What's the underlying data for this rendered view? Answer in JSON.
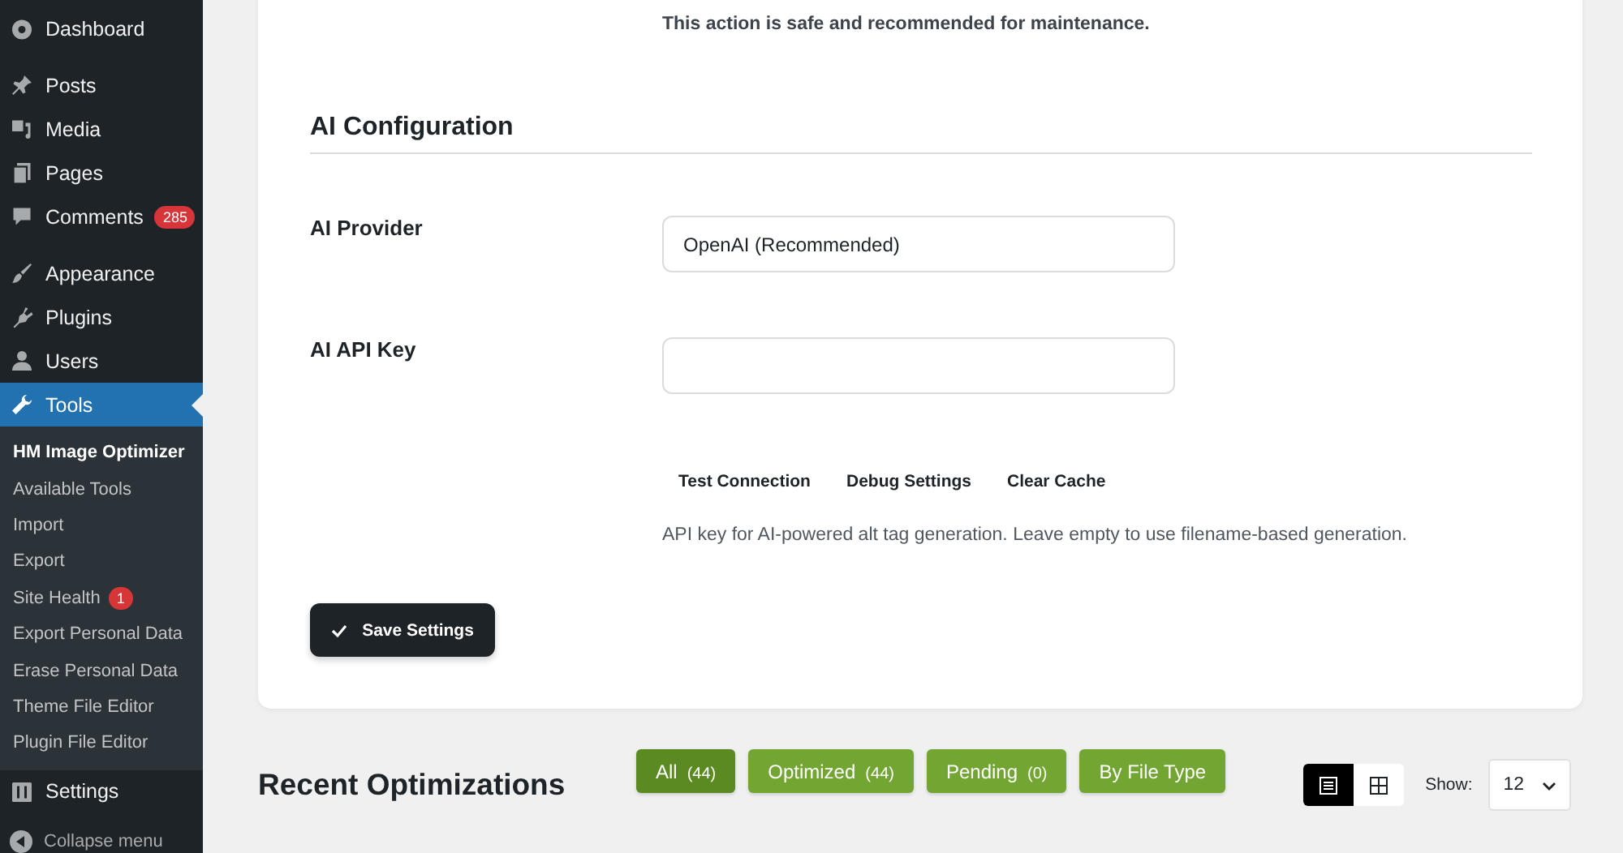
{
  "sidebar": {
    "groups": [
      {
        "items": [
          {
            "label": "Dashboard",
            "selected": false
          }
        ]
      },
      {
        "items": [
          {
            "label": "Posts",
            "selected": false
          },
          {
            "label": "Media",
            "selected": false
          },
          {
            "label": "Pages",
            "selected": false
          },
          {
            "label": "Comments",
            "selected": false,
            "badge": "285"
          }
        ]
      },
      {
        "items": [
          {
            "label": "Appearance",
            "selected": false
          },
          {
            "label": "Plugins",
            "selected": false
          },
          {
            "label": "Users",
            "selected": false
          },
          {
            "label": "Tools",
            "selected": true,
            "children": [
              {
                "label": "HM Image Optimizer",
                "selected": true
              },
              {
                "label": "Available Tools",
                "selected": false
              },
              {
                "label": "Import",
                "selected": false
              },
              {
                "label": "Export",
                "selected": false
              },
              {
                "label": "Site Health",
                "selected": false,
                "badge": "1"
              },
              {
                "label": "Export Personal Data",
                "selected": false
              },
              {
                "label": "Erase Personal Data",
                "selected": false
              },
              {
                "label": "Theme File Editor",
                "selected": false
              },
              {
                "label": "Plugin File Editor",
                "selected": false
              }
            ]
          },
          {
            "label": "Settings",
            "selected": false
          }
        ]
      }
    ],
    "collapse": "Collapse menu"
  },
  "settings_card": {
    "notes": [
      "This action is safe and recommended for maintenance."
    ],
    "section_title": "AI Configuration",
    "fields": [
      {
        "label": "AI Provider",
        "value": "OpenAI (Recommended)"
      },
      {
        "label": "AI API Key"
      }
    ],
    "actions": [
      "Test Connection",
      "Debug Settings",
      "Clear Cache"
    ],
    "help": "API key for AI-powered alt tag generation. Leave empty to use filename-based generation.",
    "save_button": "Save Settings"
  },
  "recent": {
    "title": "Recent Optimizations",
    "filters": [
      {
        "label": "All",
        "count": "(44)",
        "selected": true
      },
      {
        "label": "Optimized",
        "count": "(44)",
        "selected": false
      },
      {
        "label": "Pending",
        "count": "(0)",
        "selected": false
      },
      {
        "label": "By File Type",
        "selected": false
      }
    ],
    "views": [
      {
        "kind": "list",
        "selected": true
      },
      {
        "kind": "grid",
        "selected": false
      }
    ],
    "show_label": "Show:",
    "show_value": "12"
  }
}
